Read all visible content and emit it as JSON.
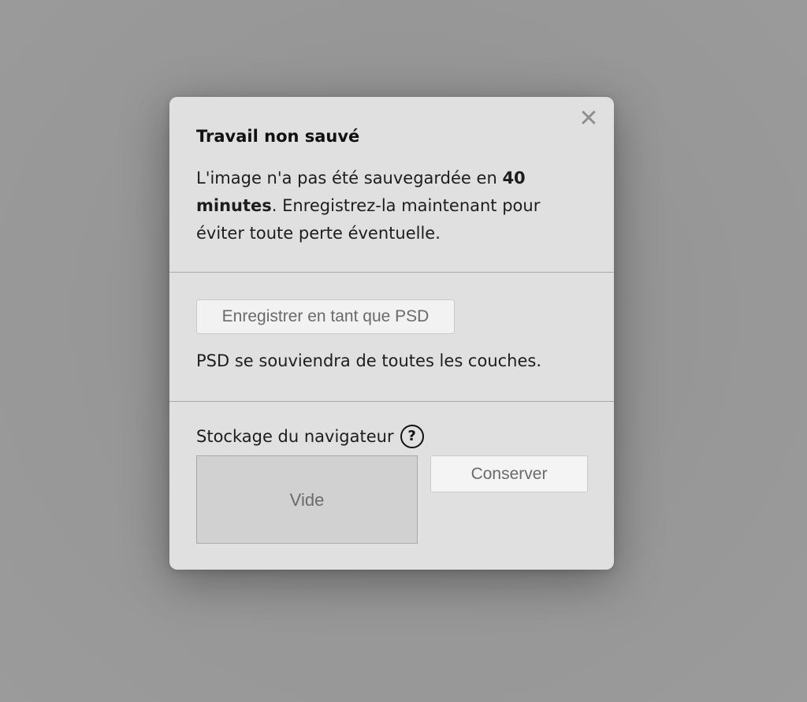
{
  "dialog": {
    "title": "Travail non sauvé",
    "message_part1": "L'image n'a pas été sauvegardée en ",
    "message_bold_time": "40 minutes",
    "message_part2": ". Enregistrez-la maintenant pour éviter toute perte éventuelle.",
    "close_glyph": "✕"
  },
  "psd_section": {
    "button_label": "Enregistrer en tant que PSD",
    "note": "PSD se souviendra de toutes les couches."
  },
  "storage_section": {
    "label": "Stockage du navigateur",
    "help_glyph": "?",
    "slot_label": "Vide",
    "keep_button_label": "Conserver"
  },
  "colors": {
    "backdrop": "#9a9a9a",
    "dialog_bg": "#e0e0e0",
    "slot_bg": "#d1d1d1"
  },
  "icons": [
    "close-icon",
    "help-icon"
  ]
}
